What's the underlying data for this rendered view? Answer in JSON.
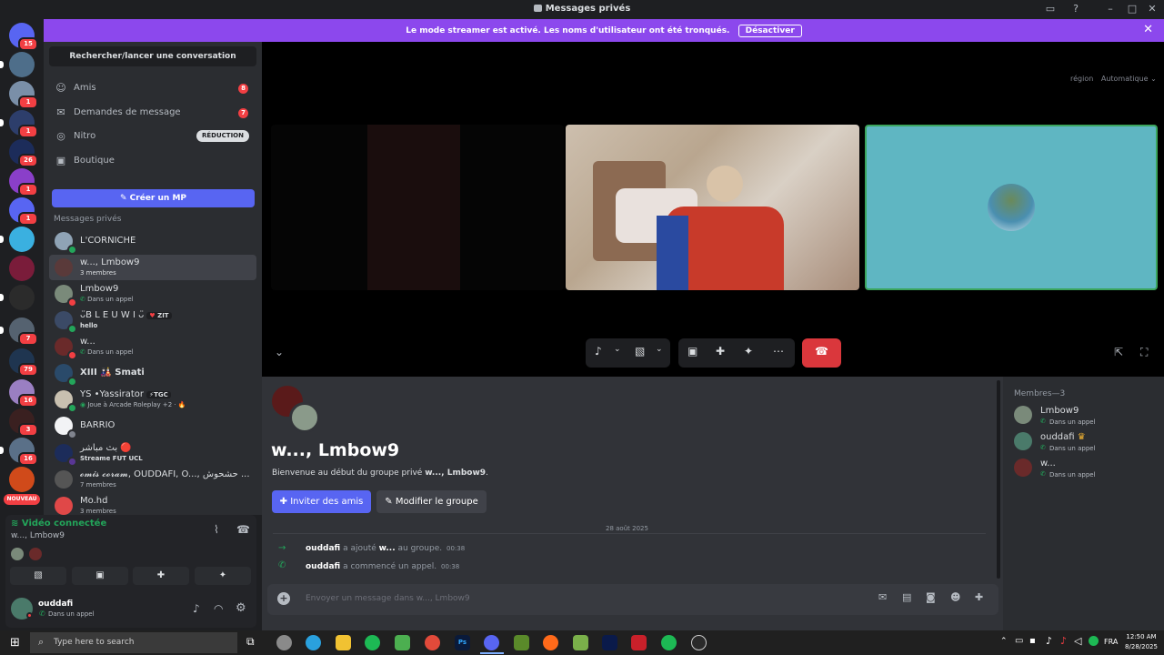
{
  "window": {
    "title": "Messages privés"
  },
  "banner": {
    "text": "Le mode streamer est activé. Les noms d'utilisateur ont été tronqués.",
    "button": "Désactiver"
  },
  "rail": {
    "badges": [
      "15",
      "1",
      "1",
      "26",
      "1",
      "1",
      "7",
      "79",
      "16",
      "3",
      "16"
    ],
    "new_label": "NOUVEAU"
  },
  "sidebar": {
    "search": "Rechercher/lancer une conversation",
    "nav": [
      {
        "label": "Amis",
        "count": "8",
        "icon": "friends-icon"
      },
      {
        "label": "Demandes de message",
        "count": "7",
        "icon": "envelope-icon"
      },
      {
        "label": "Nitro",
        "badge": "RÉDUCTION",
        "icon": "nitro-icon"
      },
      {
        "label": "Boutique",
        "icon": "shop-icon"
      }
    ],
    "create_dm": "Créer un MP",
    "section": "Messages privés",
    "dms": [
      {
        "name": "L'CORNICHE",
        "sub": ""
      },
      {
        "name": "w..., Lmbow9",
        "sub": "3 membres"
      },
      {
        "name": "Lmbow9",
        "sub": "Dans un appel"
      },
      {
        "name": "ᴗ̈B L E U W I ᴗ̈",
        "tag": "ZIT",
        "sub": "hello"
      },
      {
        "name": "w...",
        "sub": "Dans un appel"
      },
      {
        "name": "XIII 🎎 Smati",
        "sub": ""
      },
      {
        "name": "YS •Yassirator",
        "tag": "TGC",
        "sub": "Joue à Arcade Roleplay +2 · 🔥"
      },
      {
        "name": "BARRIO",
        "sub": ""
      },
      {
        "name": "بث مباشر 🔴",
        "sub": "Streame FUT UCL"
      },
      {
        "name": "𝓸𝓶𝓲𝓼 𝓬𝓸𝓻𝓪𝓶, OUDDAFI, O..., حشحوش ...",
        "sub": "7 membres"
      },
      {
        "name": "Mo.hd",
        "sub": "3 membres"
      }
    ]
  },
  "voice": {
    "status": "Vidéo connectée",
    "channel": "w..., Lmbow9"
  },
  "user": {
    "name": "ouddafi",
    "status": "Dans un appel"
  },
  "video": {
    "region_label": "région",
    "region_value": "Automatique"
  },
  "chat": {
    "title": "w..., Lmbow9",
    "welcome_prefix": "Bienvenue au début du groupe privé ",
    "welcome_name": "w..., Lmbow9",
    "welcome_suffix": ".",
    "invite_button": "Inviter des amis",
    "edit_button": "Modifier le groupe",
    "date": "28 août 2025",
    "events": [
      {
        "user": "ouddafi",
        "text": " a ajouté ",
        "target": "w...",
        "text2": " au groupe.",
        "time": "00:38"
      },
      {
        "user": "ouddafi",
        "text": " a commencé un appel.",
        "target": "",
        "text2": "",
        "time": "00:38"
      }
    ],
    "input_placeholder": "Envoyer un message dans w..., Lmbow9"
  },
  "members": {
    "header": "Membres—3",
    "list": [
      {
        "name": "Lmbow9",
        "sub": "Dans un appel"
      },
      {
        "name": "ouddafi",
        "sub": "Dans un appel"
      },
      {
        "name": "w...",
        "sub": "Dans un appel"
      }
    ]
  },
  "taskbar": {
    "search": "Type here to search",
    "lang": "FRA",
    "time": "12:50 AM",
    "date": "8/28/2025"
  },
  "colors": {
    "accent": "#5865f2",
    "banner": "#8c48ed",
    "online": "#23a55a",
    "danger": "#f23f43",
    "hangup": "#da373c"
  }
}
